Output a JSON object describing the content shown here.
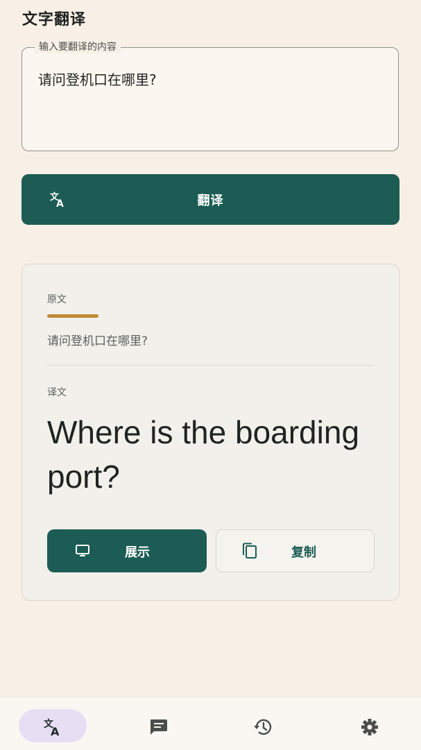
{
  "header": {
    "title": "文字翻译"
  },
  "input": {
    "legend": "输入要翻译的内容",
    "value": "请问登机口在哪里?"
  },
  "translate_button": {
    "label": "翻译",
    "icon": "translate-icon"
  },
  "result": {
    "source_label": "原文",
    "source_text": "请问登机口在哪里?",
    "target_label": "译文",
    "target_text": "Where is the boarding port?",
    "show_button": {
      "label": "展示",
      "icon": "monitor-icon"
    },
    "copy_button": {
      "label": "复制",
      "icon": "copy-icon"
    }
  },
  "nav": {
    "items": [
      {
        "icon": "translate-icon",
        "active": true
      },
      {
        "icon": "chat-icon",
        "active": false
      },
      {
        "icon": "history-icon",
        "active": false
      },
      {
        "icon": "settings-icon",
        "active": false
      }
    ]
  },
  "colors": {
    "primary": "#1c5c54",
    "accent": "#c08a34",
    "background": "#f8f0e6",
    "nav_active": "#e8def4"
  }
}
